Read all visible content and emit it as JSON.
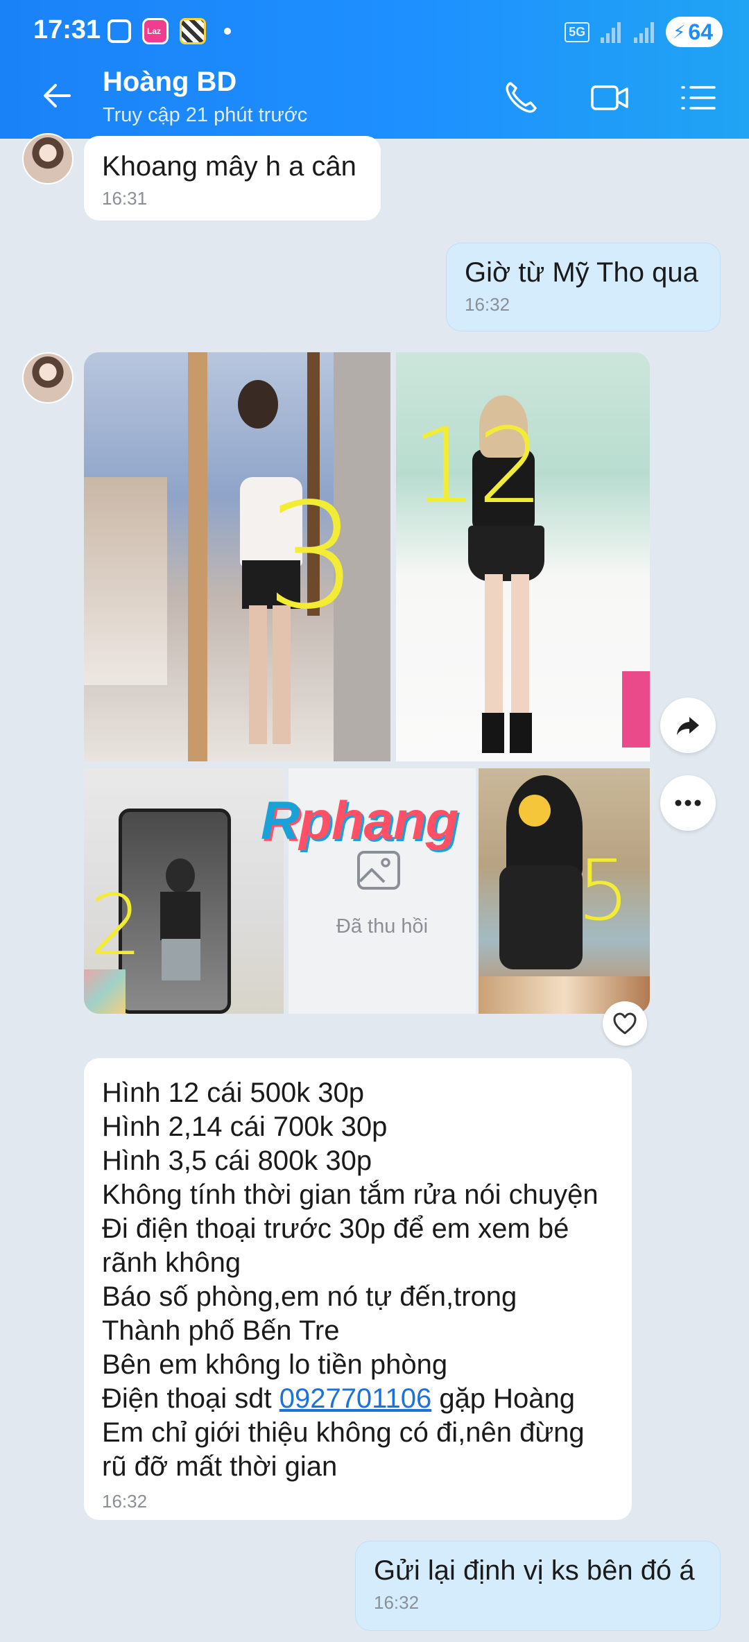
{
  "status_bar": {
    "time": "17:31",
    "network": "5G",
    "battery": "64"
  },
  "header": {
    "contact_name": "Hoàng BD",
    "last_seen": "Truy cập 21 phút trước"
  },
  "messages": {
    "m1": {
      "text": "Khoang mây h a cân",
      "time": "16:31"
    },
    "m2": {
      "text": "Giờ từ Mỹ Tho qua",
      "time": "16:32"
    },
    "photos": {
      "p1_number": "3",
      "p2_number": "12",
      "p3_number": "2",
      "p5_number": "5",
      "recalled_label": "Đã thu hồi",
      "watermark_r": "R",
      "watermark_rest": "phang"
    },
    "m3": {
      "lines": [
        "Hình 12 cái 500k 30p",
        "Hình 2,14 cái 700k 30p",
        "Hình 3,5 cái 800k 30p",
        "Không tính thời gian tắm rửa nói chuyện",
        "Đi điện thoại trước 30p để em xem bé",
        "rãnh không",
        "Báo số phòng,em nó tự đến,trong",
        "Thành phố Bến Tre",
        "Bên em không lo tiền phòng"
      ],
      "phone_prefix": "Điện thoại sdt ",
      "phone_number": "0927701106",
      "phone_suffix": " gặp Hoàng",
      "lines_after": [
        "Em chỉ giới thiệu không có đi,nên đừng",
        "rũ đỡ mất thời gian"
      ],
      "time": "16:32"
    },
    "m4": {
      "text": "Gửi lại định vị ks bên đó á",
      "time": "16:32"
    }
  },
  "icons": [
    "back-arrow-icon",
    "phone-icon",
    "video-icon",
    "menu-list-icon",
    "share-icon",
    "more-icon",
    "heart-icon",
    "image-icon"
  ]
}
